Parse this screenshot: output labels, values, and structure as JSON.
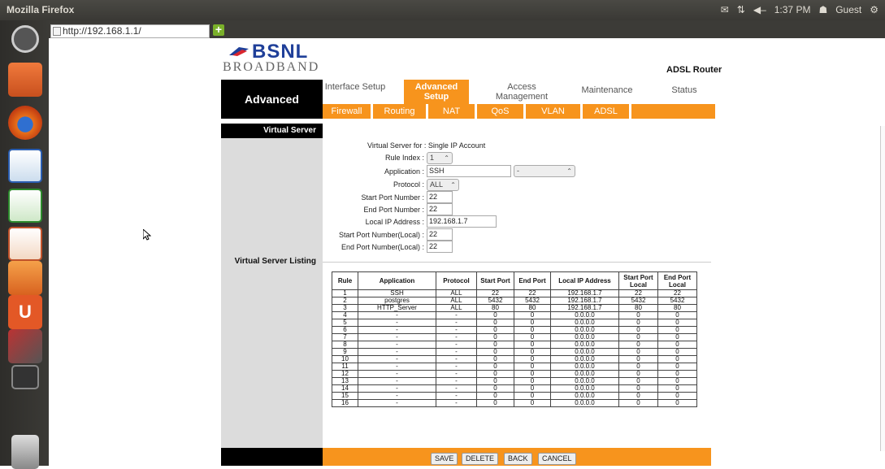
{
  "os": {
    "window_title": "Mozilla Firefox",
    "tray": {
      "time": "1:37 PM",
      "user": "Guest"
    }
  },
  "browser": {
    "url": "http://192.168.1.1/"
  },
  "router": {
    "brand_top": "BSNL",
    "brand_bottom": "BROADBAND",
    "model": "ADSL Router",
    "section": "Advanced",
    "main_tabs": [
      {
        "label": "Interface Setup"
      },
      {
        "label": "Advanced Setup"
      },
      {
        "label": "Access Management"
      },
      {
        "label": "Maintenance"
      },
      {
        "label": "Status"
      }
    ],
    "sub_tabs": [
      "Firewall",
      "Routing",
      "NAT",
      "QoS",
      "VLAN",
      "ADSL"
    ],
    "left": {
      "virtual_server": "Virtual Server",
      "listing": "Virtual Server Listing"
    },
    "form": {
      "vs_for_label": "Virtual Server for :",
      "vs_for_value": "Single IP Account",
      "rule_index_label": "Rule Index :",
      "rule_index_value": "1",
      "application_label": "Application :",
      "application_value": "SSH",
      "application_select": "-",
      "protocol_label": "Protocol :",
      "protocol_value": "ALL",
      "start_port_label": "Start Port Number :",
      "start_port_value": "22",
      "end_port_label": "End Port Number :",
      "end_port_value": "22",
      "local_ip_label": "Local IP Address :",
      "local_ip_value": "192.168.1.7",
      "start_local_label": "Start Port Number(Local) :",
      "start_local_value": "22",
      "end_local_label": "End Port Number(Local) :",
      "end_local_value": "22"
    },
    "table": {
      "headers": [
        "Rule",
        "Application",
        "Protocol",
        "Start Port",
        "End Port",
        "Local IP Address",
        "Start Port Local",
        "End Port Local"
      ],
      "rows": [
        [
          "1",
          "SSH",
          "ALL",
          "22",
          "22",
          "192.168.1.7",
          "22",
          "22"
        ],
        [
          "2",
          "postgres",
          "ALL",
          "5432",
          "5432",
          "192.168.1.7",
          "5432",
          "5432"
        ],
        [
          "3",
          "HTTP_Server",
          "ALL",
          "80",
          "80",
          "192.168.1.7",
          "80",
          "80"
        ],
        [
          "4",
          "-",
          "-",
          "0",
          "0",
          "0.0.0.0",
          "0",
          "0"
        ],
        [
          "5",
          "-",
          "-",
          "0",
          "0",
          "0.0.0.0",
          "0",
          "0"
        ],
        [
          "6",
          "-",
          "-",
          "0",
          "0",
          "0.0.0.0",
          "0",
          "0"
        ],
        [
          "7",
          "-",
          "-",
          "0",
          "0",
          "0.0.0.0",
          "0",
          "0"
        ],
        [
          "8",
          "-",
          "-",
          "0",
          "0",
          "0.0.0.0",
          "0",
          "0"
        ],
        [
          "9",
          "-",
          "-",
          "0",
          "0",
          "0.0.0.0",
          "0",
          "0"
        ],
        [
          "10",
          "-",
          "-",
          "0",
          "0",
          "0.0.0.0",
          "0",
          "0"
        ],
        [
          "11",
          "-",
          "-",
          "0",
          "0",
          "0.0.0.0",
          "0",
          "0"
        ],
        [
          "12",
          "-",
          "-",
          "0",
          "0",
          "0.0.0.0",
          "0",
          "0"
        ],
        [
          "13",
          "-",
          "-",
          "0",
          "0",
          "0.0.0.0",
          "0",
          "0"
        ],
        [
          "14",
          "-",
          "-",
          "0",
          "0",
          "0.0.0.0",
          "0",
          "0"
        ],
        [
          "15",
          "-",
          "-",
          "0",
          "0",
          "0.0.0.0",
          "0",
          "0"
        ],
        [
          "16",
          "-",
          "-",
          "0",
          "0",
          "0.0.0.0",
          "0",
          "0"
        ]
      ]
    },
    "buttons": {
      "save": "SAVE",
      "delete": "DELETE",
      "back": "BACK",
      "cancel": "CANCEL"
    }
  },
  "colors": {
    "accent": "#f7941d",
    "brand_blue": "#1f3f99"
  }
}
